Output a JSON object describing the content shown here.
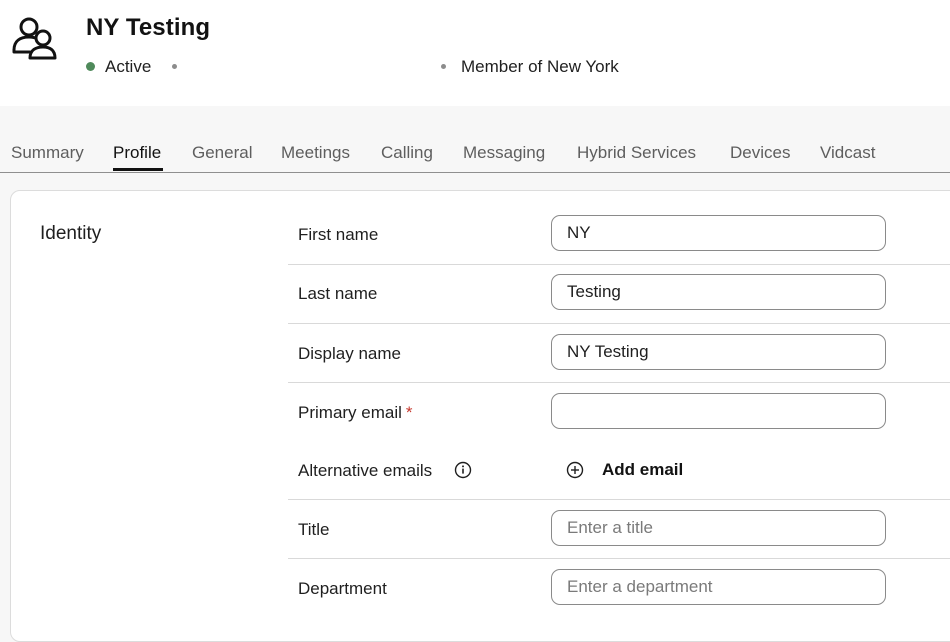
{
  "header": {
    "title": "NY Testing",
    "status": "Active",
    "status_color": "#4f8a5b",
    "member_of": "Member of New York",
    "avatar_icon": "group-users-icon"
  },
  "tabs": [
    {
      "label": "Summary",
      "active": false
    },
    {
      "label": "Profile",
      "active": true
    },
    {
      "label": "General",
      "active": false
    },
    {
      "label": "Meetings",
      "active": false
    },
    {
      "label": "Calling",
      "active": false
    },
    {
      "label": "Messaging",
      "active": false
    },
    {
      "label": "Hybrid Services",
      "active": false
    },
    {
      "label": "Devices",
      "active": false
    },
    {
      "label": "Vidcast",
      "active": false
    }
  ],
  "identity": {
    "section_title": "Identity",
    "fields": {
      "first_name": {
        "label": "First name",
        "value": "NY",
        "placeholder": ""
      },
      "last_name": {
        "label": "Last name",
        "value": "Testing",
        "placeholder": ""
      },
      "display_name": {
        "label": "Display name",
        "value": "NY Testing",
        "placeholder": ""
      },
      "primary_email": {
        "label": "Primary email",
        "required_mark": "*",
        "value": "",
        "placeholder": ""
      },
      "alternative_emails": {
        "label": "Alternative emails",
        "info_icon": "info-icon",
        "add_label": "Add email",
        "add_icon": "plus-circle-icon"
      },
      "title": {
        "label": "Title",
        "value": "",
        "placeholder": "Enter a title"
      },
      "department": {
        "label": "Department",
        "value": "",
        "placeholder": "Enter a department"
      }
    }
  },
  "colors": {
    "required": "#c6382d",
    "active_status": "#4f8a5b"
  }
}
